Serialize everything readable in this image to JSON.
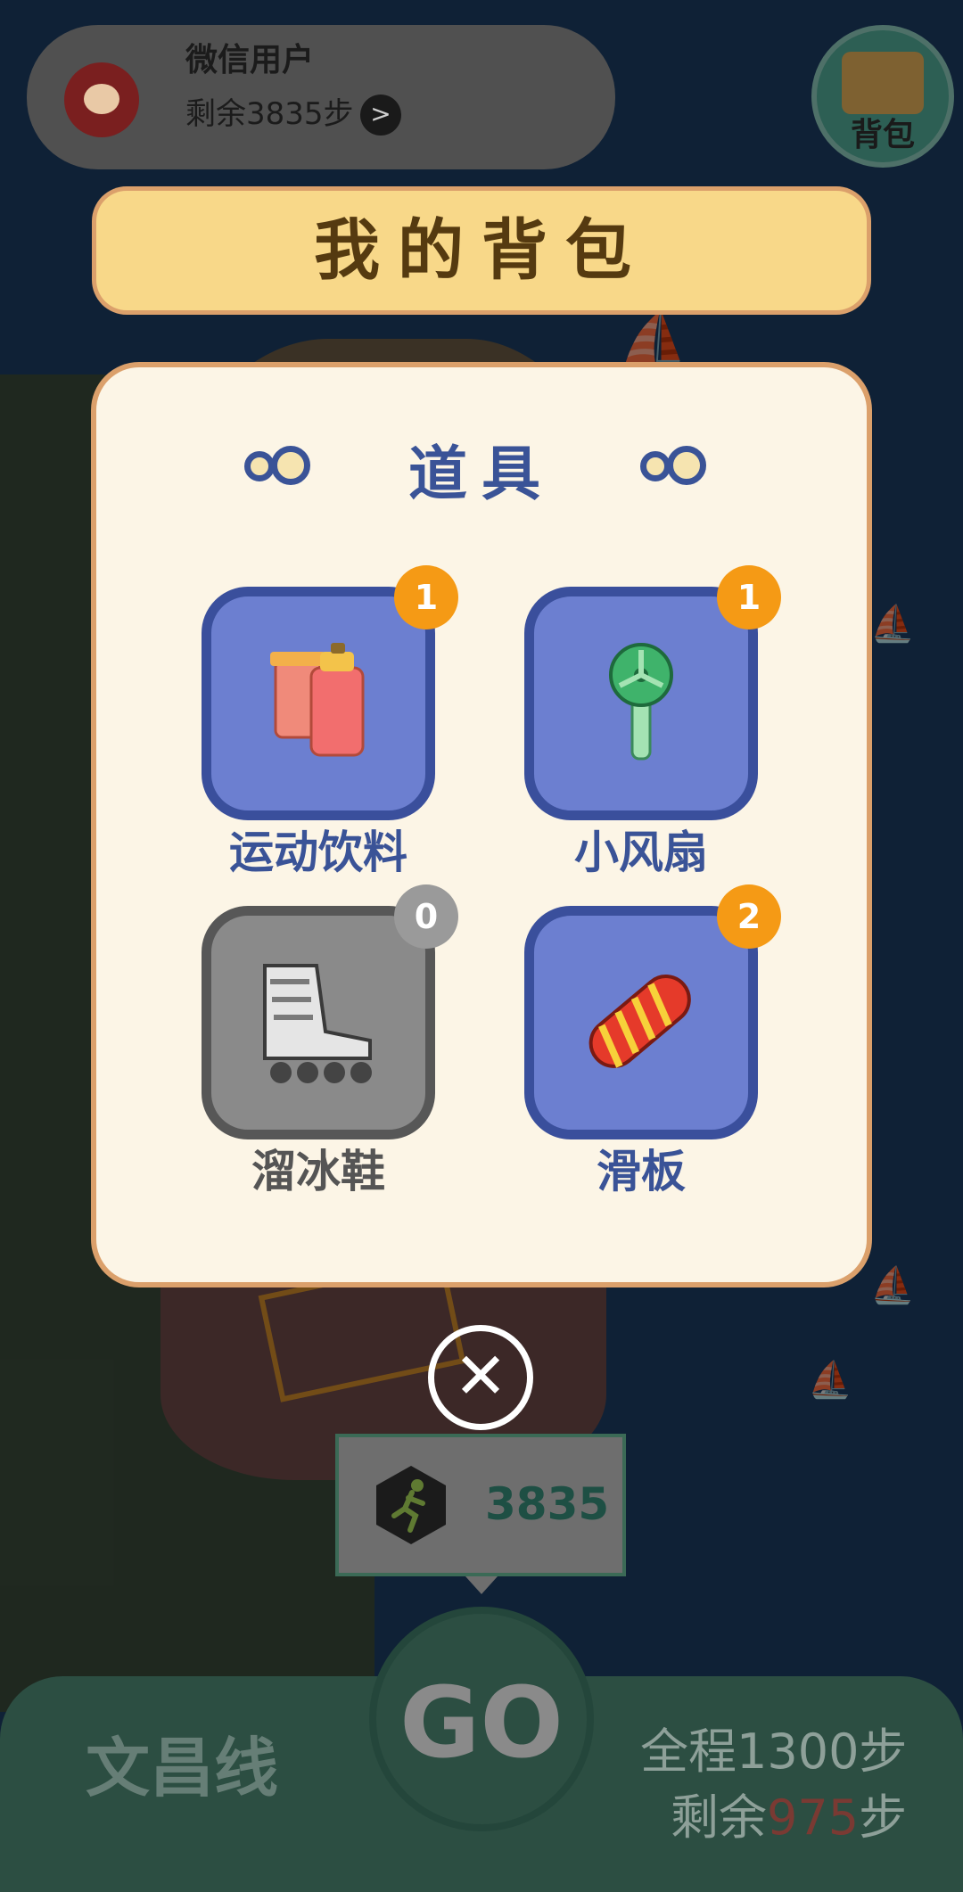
{
  "user": {
    "name": "微信用户",
    "steps_remaining": "剩余3835步",
    "arrow": ">"
  },
  "bag_button": {
    "label": "背包"
  },
  "dialog": {
    "title": "我的背包",
    "section_title": "道具",
    "items": [
      {
        "name": "运动饮料",
        "count": "1",
        "icon": "sports-drink-icon",
        "available": true
      },
      {
        "name": "小风扇",
        "count": "1",
        "icon": "hand-fan-icon",
        "available": true
      },
      {
        "name": "溜冰鞋",
        "count": "0",
        "icon": "roller-skate-icon",
        "available": false
      },
      {
        "name": "滑板",
        "count": "2",
        "icon": "skateboard-icon",
        "available": true
      }
    ],
    "close": "✕"
  },
  "step_tooltip": {
    "count": "3835"
  },
  "bottom": {
    "line_name": "文昌线",
    "go": "GO",
    "total": "全程1300步",
    "remain_prefix": "剩余",
    "remain_num": "975",
    "remain_suffix": "步"
  },
  "colors": {
    "accent_blue": "#3a5397",
    "badge_orange": "#f59a15",
    "banner": "#f8d889"
  }
}
